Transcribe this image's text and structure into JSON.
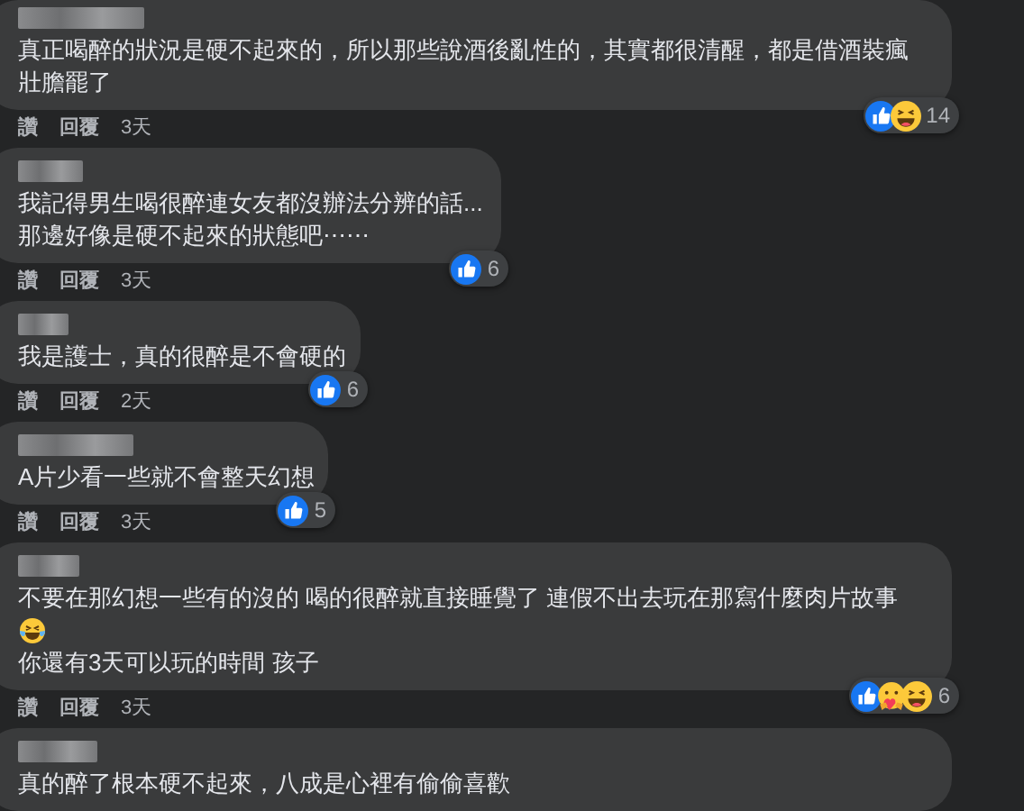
{
  "comments": [
    {
      "lines": [
        {
          "kind": "text",
          "text": "真正喝醉的狀況是硬不起來的，所以那些說酒後亂性的，其實都很清醒，都是借酒裝瘋"
        },
        {
          "kind": "text",
          "text": "壯膽罷了"
        }
      ],
      "reactions": [
        {
          "kind": "like"
        },
        {
          "kind": "haha"
        }
      ],
      "reaction_count": "14",
      "actions": [
        "讚",
        "回覆"
      ],
      "time": "3天"
    },
    {
      "lines": [
        {
          "kind": "text",
          "text": "我記得男生喝很醉連女友都沒辦法分辨的話..."
        },
        {
          "kind": "text",
          "text": "那邊好像是硬不起來的狀態吧⋯⋯"
        }
      ],
      "reactions": [
        {
          "kind": "like"
        }
      ],
      "reaction_count": "6",
      "actions": [
        "讚",
        "回覆"
      ],
      "time": "3天"
    },
    {
      "lines": [
        {
          "kind": "text",
          "text": "我是護士，真的很醉是不會硬的"
        }
      ],
      "reactions": [
        {
          "kind": "like"
        }
      ],
      "reaction_count": "6",
      "actions": [
        "讚",
        "回覆"
      ],
      "time": "2天"
    },
    {
      "lines": [
        {
          "kind": "text",
          "text": "A片少看一些就不會整天幻想"
        }
      ],
      "reactions": [
        {
          "kind": "like"
        }
      ],
      "reaction_count": "5",
      "actions": [
        "讚",
        "回覆"
      ],
      "time": "3天"
    },
    {
      "lines": [
        {
          "kind": "text",
          "text": "不要在那幻想一些有的沒的 喝的很醉就直接睡覺了 連假不出去玩在那寫什麼肉片故事"
        },
        {
          "kind": "emoji"
        },
        {
          "kind": "text",
          "text": "你還有3天可以玩的時間 孩子"
        }
      ],
      "reactions": [
        {
          "kind": "like"
        },
        {
          "kind": "care"
        },
        {
          "kind": "haha"
        }
      ],
      "reaction_count": "6",
      "actions": [
        "讚",
        "回覆"
      ],
      "time": "3天"
    },
    {
      "lines": [
        {
          "kind": "text",
          "text": "真的醉了根本硬不起來，八成是心裡有偷偷喜歡"
        }
      ]
    }
  ]
}
